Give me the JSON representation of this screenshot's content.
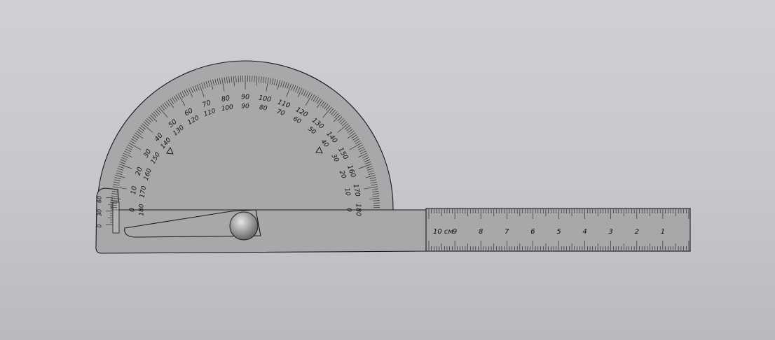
{
  "protractor": {
    "outer_scale_labels": [
      "0",
      "10",
      "20",
      "30",
      "40",
      "50",
      "60",
      "70",
      "80",
      "90",
      "100",
      "110",
      "120",
      "130",
      "140",
      "150",
      "160",
      "170",
      "180"
    ],
    "inner_scale_labels": [
      "180",
      "170",
      "160",
      "150",
      "140",
      "130",
      "120",
      "110",
      "100",
      "90",
      "80",
      "70",
      "60",
      "50",
      "40",
      "30",
      "20",
      "10",
      "0"
    ],
    "vernier_labels": [
      "0",
      "30",
      "60"
    ]
  },
  "ruler": {
    "labels": [
      "10 см",
      "9",
      "8",
      "7",
      "6",
      "5",
      "4",
      "3",
      "2",
      "1"
    ]
  },
  "colors": {
    "background_top": "#cfd0d5",
    "background_bottom": "#b9babf",
    "body": "#a8a8aa",
    "outline": "#1a1a1a",
    "knob": "#8e8e90"
  },
  "icons": {
    "pivot": "pivot-knob-icon",
    "triangle_marker": "triangle-marker-icon"
  }
}
